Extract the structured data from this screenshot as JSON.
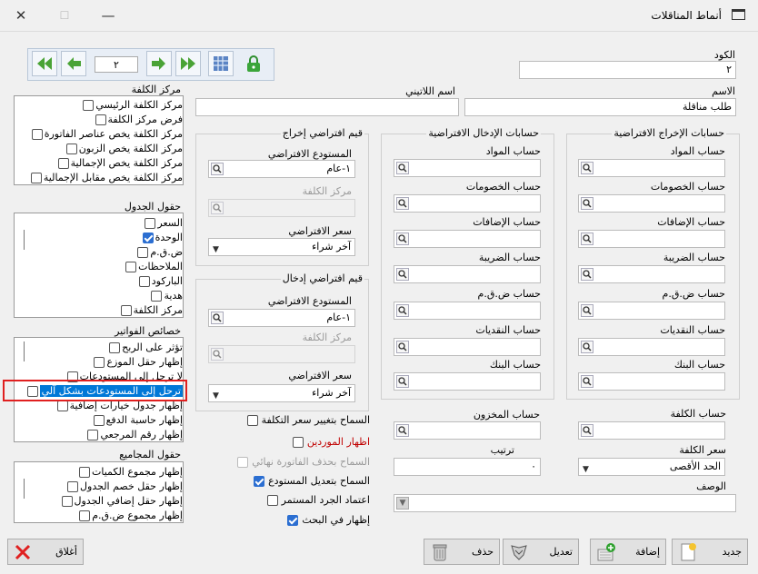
{
  "window": {
    "title": "أنماط المناقلات"
  },
  "nav": {
    "page": "٢"
  },
  "header": {
    "code_label": "الكود",
    "code_value": "٢",
    "name_label": "الاسم",
    "name_value": "طلب مناقلة",
    "latin_name_label": "اسم اللاتيني",
    "latin_name_value": ""
  },
  "cost_center": {
    "title": "مركز الكلفة",
    "items": [
      {
        "label": "مركز الكلفة الرئيسي",
        "checked": false
      },
      {
        "label": "فرض مركز الكلفة",
        "checked": false
      },
      {
        "label": "مركز الكلفة يخص عناصر الفاتورة",
        "checked": false
      },
      {
        "label": "مركز الكلفة يخص الزبون",
        "checked": false
      },
      {
        "label": "مركز الكلفة يخص الإجمالية",
        "checked": false
      },
      {
        "label": "مركز الكلفة يخص مقابل الإجمالية",
        "checked": false
      }
    ]
  },
  "table_fields": {
    "title": "حقول الجدول",
    "items": [
      {
        "label": "السعر",
        "checked": false
      },
      {
        "label": "الوحدة",
        "checked": true
      },
      {
        "label": "ض.ق.م",
        "checked": false
      },
      {
        "label": "الملاحظات",
        "checked": false
      },
      {
        "label": "الباركود",
        "checked": false
      },
      {
        "label": "هدية",
        "checked": false
      },
      {
        "label": "مركز الكلفة",
        "checked": false
      }
    ]
  },
  "invoice_props": {
    "title": "خصائص الفواتير",
    "items": [
      {
        "label": "تؤثر على الربح",
        "checked": false
      },
      {
        "label": "إظهار حقل الموزع",
        "checked": false
      },
      {
        "label": "لا ترحل إلى المستودعات",
        "checked": false
      },
      {
        "label": "ترحل إلى المستودعات بشكل آلي",
        "checked": false
      },
      {
        "label": "إظهار جدول خيارات إضافية",
        "checked": false
      },
      {
        "label": "إظهار حاسبة الدفع",
        "checked": false
      },
      {
        "label": "إظهار رقم المرجعي",
        "checked": false
      }
    ]
  },
  "totals_fields": {
    "title": "حقول المجاميع",
    "items": [
      {
        "label": "إظهار مجموع الكميات",
        "checked": false
      },
      {
        "label": "إظهار حقل خصم الجدول",
        "checked": false
      },
      {
        "label": "إظهار حقل إضافي الجدول",
        "checked": false
      },
      {
        "label": "إظهار مجموع ض.ق.م",
        "checked": false
      }
    ]
  },
  "out_defaults": {
    "title": "قيم افتراضي إخراج",
    "warehouse_label": "المستودع الافتراضي",
    "warehouse_value": "١-عام",
    "cost_center_label": "مركز الكلفة",
    "cost_center_value": "",
    "price_label": "سعر الافتراضي",
    "price_value": "آخر شراء"
  },
  "in_defaults": {
    "title": "قيم افتراضي إدخال",
    "warehouse_label": "المستودع الافتراضي",
    "warehouse_value": "١-عام",
    "cost_center_label": "مركز الكلفة",
    "cost_center_value": "",
    "price_label": "سعر الافتراضي",
    "price_value": "آخر شراء"
  },
  "in_accounts": {
    "title": "حسابات الإدخال الافتراضية",
    "labels": [
      "حساب المواد",
      "حساب الخصومات",
      "حساب الإضافات",
      "حساب الضريبة",
      "حساب ض.ق.م",
      "حساب النقديات",
      "حساب البنك"
    ]
  },
  "out_accounts": {
    "title": "حسابات الإخراج الافتراضية",
    "labels": [
      "حساب المواد",
      "حساب الخصومات",
      "حساب الإضافات",
      "حساب الضريبة",
      "حساب ض.ق.م",
      "حساب النقديات",
      "حساب البنك"
    ]
  },
  "options": [
    {
      "label": "السماح بتغيير سعر التكلفة",
      "checked": false,
      "color": "#000000"
    },
    {
      "label": "اظهار الموردين",
      "checked": false,
      "color": "#c00000"
    },
    {
      "label": "السماح بحذف الفاتورة نهائي",
      "checked": false,
      "color": "#9a9a9a"
    },
    {
      "label": "السماح بتعديل المستودع",
      "checked": true,
      "color": "#000000"
    },
    {
      "label": "اعتماد الجرد المستمر",
      "checked": false,
      "color": "#000000"
    },
    {
      "label": "إظهار في البحث",
      "checked": true,
      "color": "#000000"
    }
  ],
  "store_account": {
    "label": "حساب المخزون",
    "value": ""
  },
  "order": {
    "label": "ترتيب",
    "value": "٠"
  },
  "cost_account": {
    "label": "حساب الكلفة",
    "value": ""
  },
  "cost_price": {
    "label": "سعر الكلفة",
    "value": "الحد الأقصى"
  },
  "description": {
    "label": "الوصف",
    "value": ""
  },
  "buttons": {
    "new": "جديد",
    "add": "إضافة",
    "edit": "تعديل",
    "delete": "حذف",
    "close": "أغلاق"
  },
  "colors": {
    "accent": "#2b6ed1",
    "highlight": "#0078d7",
    "red": "#e02020",
    "green": "#2fa12f"
  }
}
